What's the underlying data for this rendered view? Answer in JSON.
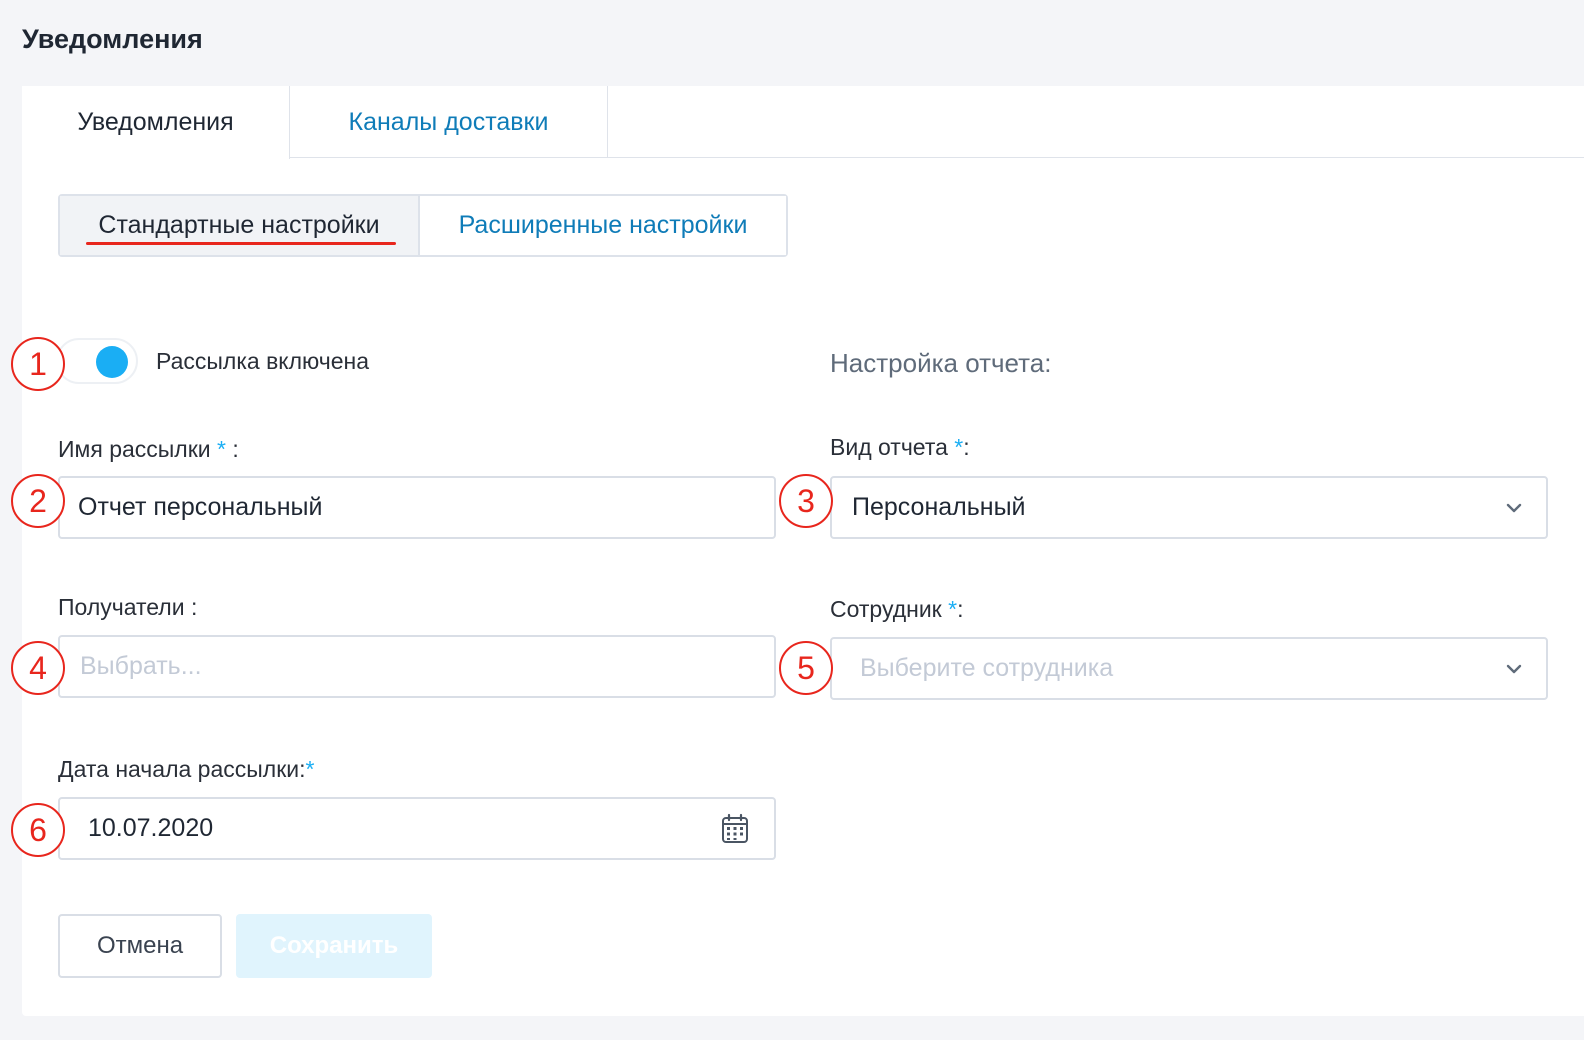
{
  "page": {
    "title": "Уведомления"
  },
  "tabs": [
    {
      "label": "Уведомления",
      "active": true
    },
    {
      "label": "Каналы доставки",
      "active": false
    }
  ],
  "segments": [
    {
      "label": "Стандартные настройки",
      "active": true
    },
    {
      "label": "Расширенные настройки",
      "active": false
    }
  ],
  "markers": [
    "1",
    "2",
    "3",
    "4",
    "5",
    "6"
  ],
  "toggle": {
    "label": "Рассылка включена",
    "on": true
  },
  "report_section": {
    "title": "Настройка отчета:"
  },
  "fields": {
    "mailing_name": {
      "label": "Имя рассылки ",
      "required_mark": "*",
      "suffix": " :",
      "value": "Отчет персональный"
    },
    "report_type": {
      "label": "Вид отчета ",
      "required_mark": "*",
      "suffix": ":",
      "value": "Персональный"
    },
    "recipients": {
      "label": "Получатели :",
      "placeholder": "Выбрать..."
    },
    "employee": {
      "label": "Сотрудник ",
      "required_mark": "*",
      "suffix": ":",
      "placeholder": "Выберите сотрудника"
    },
    "start_date": {
      "label": "Дата начала рассылки:",
      "required_mark": "*",
      "value": "10.07.2020"
    }
  },
  "buttons": {
    "cancel": "Отмена",
    "save": "Сохранить"
  },
  "colors": {
    "accent": "#1aaef4",
    "link": "#0f7cb8",
    "annotation": "#e8261d",
    "save_disabled_bg": "#e0f4fd"
  },
  "icons": {
    "select": "chevron-down-icon",
    "date": "calendar-icon"
  }
}
